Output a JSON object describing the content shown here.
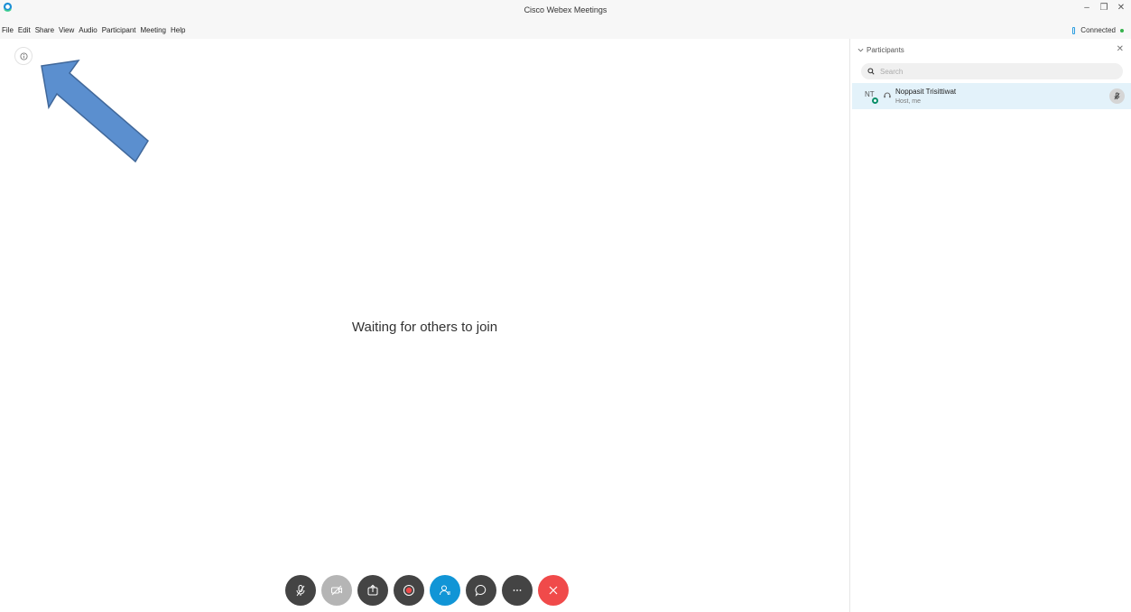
{
  "window": {
    "title": "Cisco Webex Meetings"
  },
  "menu": [
    "File",
    "Edit",
    "Share",
    "View",
    "Audio",
    "Participant",
    "Meeting",
    "Help"
  ],
  "status": {
    "connection": "Connected"
  },
  "stage": {
    "message": "Waiting for others to join"
  },
  "panel": {
    "title": "Participants",
    "search_placeholder": "Search",
    "participants": [
      {
        "initials": "NT",
        "name": "Noppasit Trisittiwat",
        "role": "Host, me"
      }
    ]
  },
  "controls": [
    "mute-mic",
    "stop-video",
    "share",
    "record",
    "participants",
    "chat",
    "more",
    "end-meeting"
  ],
  "colors": {
    "accent_blue": "#1195d6",
    "end_red": "#f04a4a",
    "control_dark": "#444444",
    "connected_green": "#37b24d",
    "arrow_blue": "#5b8fcf"
  }
}
